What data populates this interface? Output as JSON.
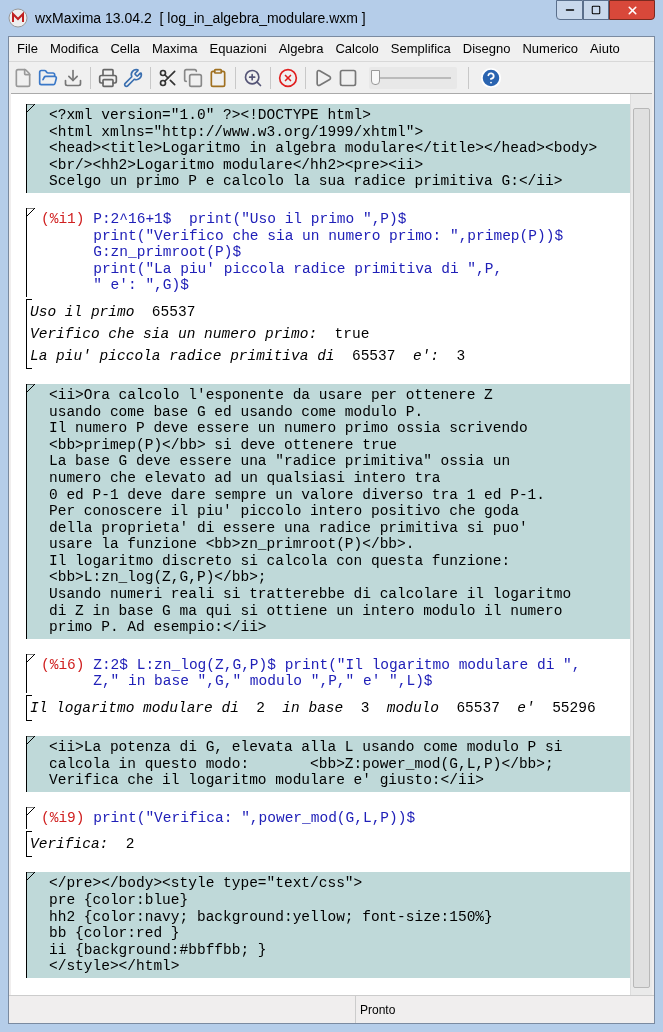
{
  "window": {
    "title": "wxMaxima 13.04.2  [ log_in_algebra_modulare.wxm ]"
  },
  "menu": [
    "File",
    "Modifica",
    "Cella",
    "Maxima",
    "Equazioni",
    "Algebra",
    "Calcolo",
    "Semplifica",
    "Disegno",
    "Numerico",
    "Aiuto"
  ],
  "toolbar": {
    "slider": {
      "level": 0
    }
  },
  "cells": [
    {
      "kind": "text",
      "lines": [
        "<?xml version=\"1.0\" ?><!DOCTYPE html>",
        "<html xmlns=\"http://www.w3.org/1999/xhtml\">",
        "<head><title>Logaritmo in algebra modulare</title></head><body>",
        "<br/><hh2>Logaritmo modulare</hh2><pre><ii>",
        "Scelgo un primo P e calcolo la sua radice primitiva G:</ii>"
      ]
    },
    {
      "kind": "input",
      "prompt": "(%i1)",
      "code": [
        "P:2^16+1$  print(\"Uso il primo \",P)$",
        "print(\"Verifico che sia un numero primo: \",primep(P))$",
        "G:zn_primroot(P)$",
        "print(\"La piu' piccola radice primitiva di \",P,",
        "\" e': \",G)$"
      ],
      "output": [
        "*Uso il primo*  65537",
        "*Verifico che sia un numero primo:*  true",
        "*La piu' piccola radice primitiva di*  65537  *e':*  3"
      ]
    },
    {
      "kind": "text",
      "lines": [
        "<ii>Ora calcolo l'esponente da usare per ottenere Z",
        "usando come base G ed usando come modulo P.",
        "Il numero P deve essere un numero primo ossia scrivendo",
        "<bb>primep(P)</bb> si deve ottenere true",
        "La base G deve essere una \"radice primitiva\" ossia un",
        "numero che elevato ad un qualsiasi intero tra",
        "0 ed P-1 deve dare sempre un valore diverso tra 1 ed P-1.",
        "Per conoscere il piu' piccolo intero positivo che goda",
        "della proprieta' di essere una radice primitiva si puo'",
        "usare la funzione <bb>zn_primroot(P)</bb>.",
        "Il logaritmo discreto si calcola con questa funzione:",
        "<bb>L:zn_log(Z,G,P)</bb>;",
        "Usando numeri reali si tratterebbe di calcolare il logaritmo",
        "di Z in base G ma qui si ottiene un intero modulo il numero",
        "primo P. Ad esempio:</ii>"
      ]
    },
    {
      "kind": "input",
      "prompt": "(%i6)",
      "code": [
        "Z:2$ L:zn_log(Z,G,P)$ print(\"Il logaritmo modulare di \",",
        "Z,\" in base \",G,\" modulo \",P,\" e' \",L)$"
      ],
      "output": [
        "*Il logaritmo modulare di*  2  *in base*  3  *modulo*  65537  *e'*  55296"
      ]
    },
    {
      "kind": "text",
      "lines": [
        "<ii>La potenza di G, elevata alla L usando come modulo P si",
        "calcola in questo modo:       <bb>Z:power_mod(G,L,P)</bb>;",
        "Verifica che il logaritmo modulare e' giusto:</ii>"
      ]
    },
    {
      "kind": "input",
      "prompt": "(%i9)",
      "code": [
        "print(\"Verifica: \",power_mod(G,L,P))$"
      ],
      "output": [
        "*Verifica:*  2"
      ]
    },
    {
      "kind": "text",
      "lines": [
        "</pre></body><style type=\"text/css\">",
        "pre {color:blue}",
        "hh2 {color:navy; background:yellow; font-size:150%}",
        "bb {color:red }",
        "ii {background:#bbffbb; }",
        "</style></html>"
      ]
    }
  ],
  "status_bar": {
    "text": "Pronto"
  }
}
